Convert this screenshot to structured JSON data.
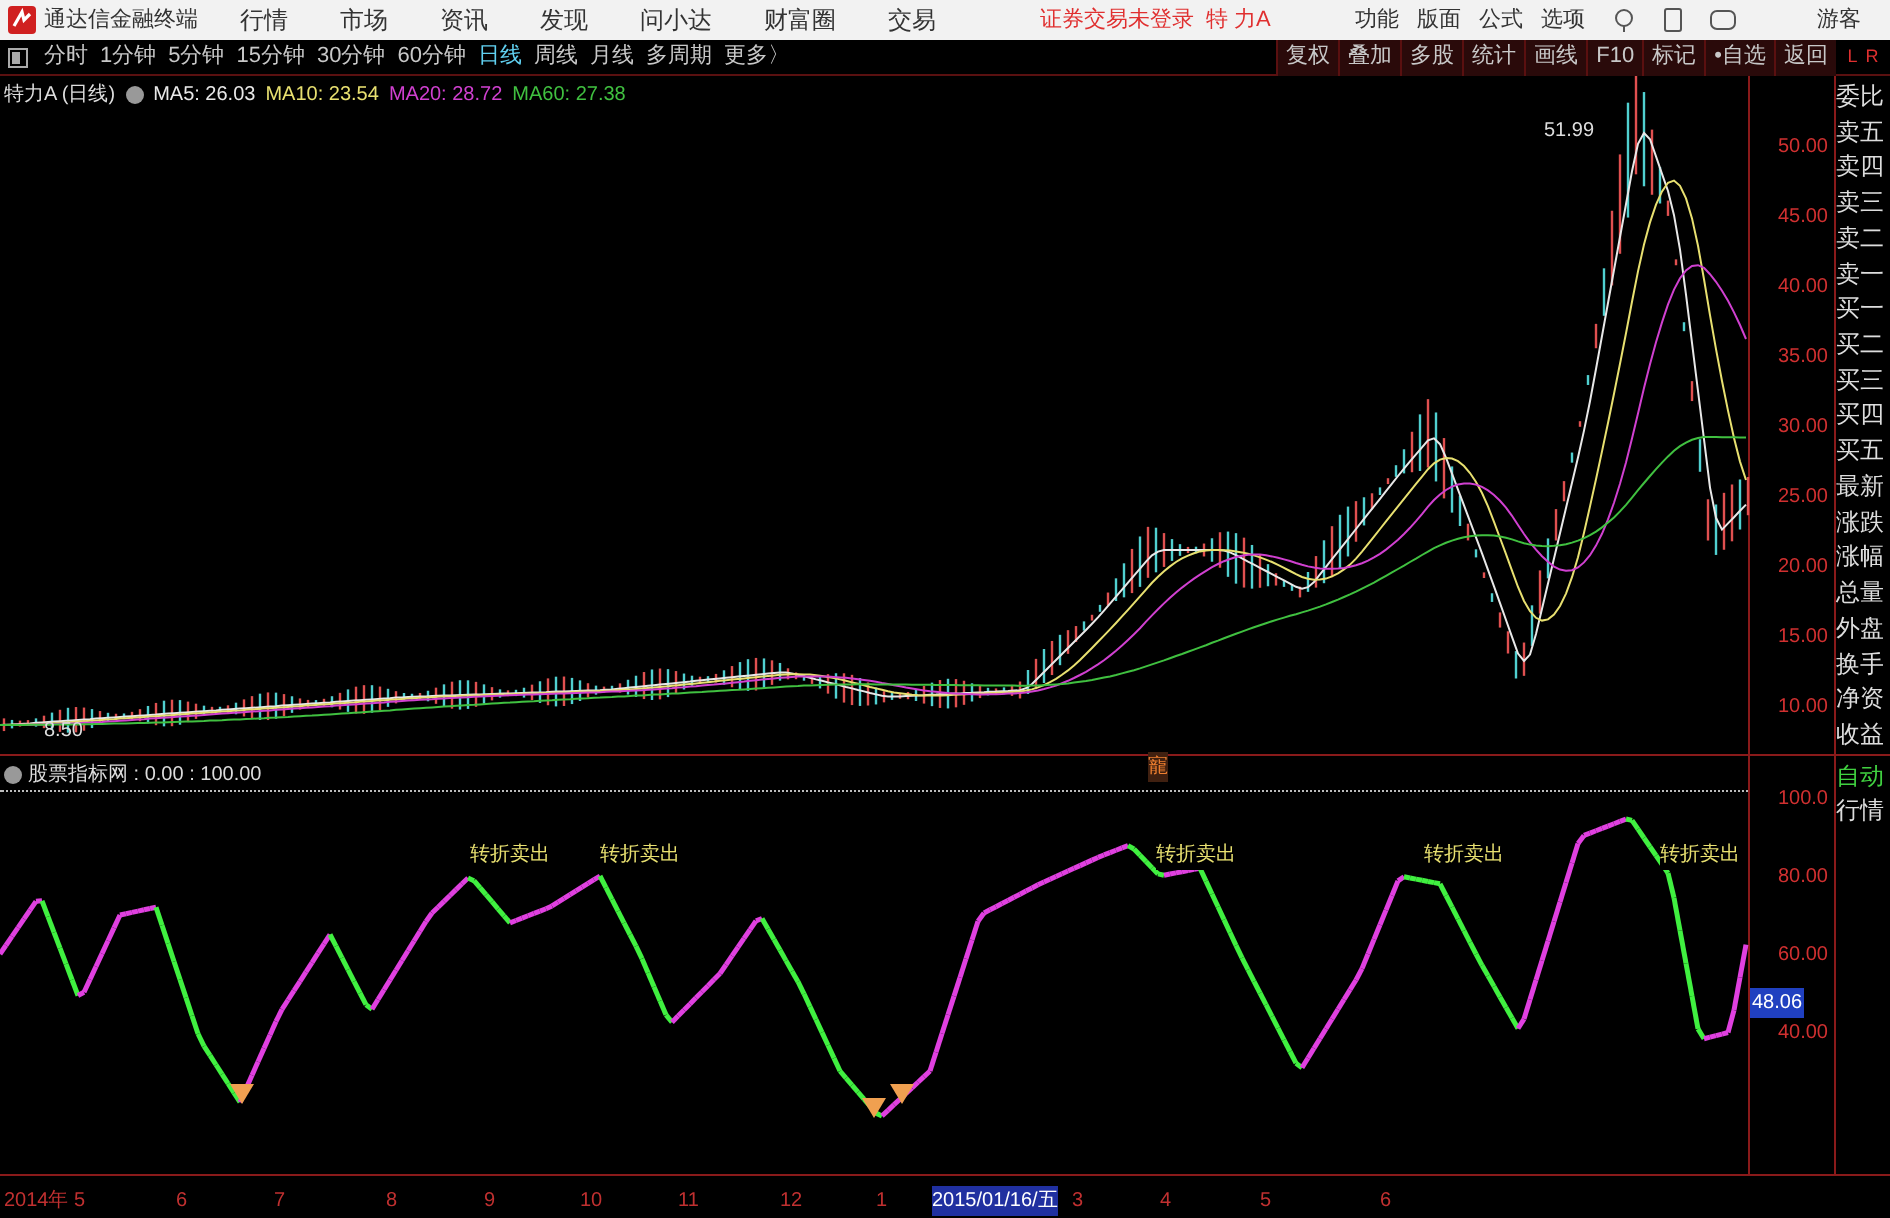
{
  "menu_bar": {
    "app_title": "通达信金融终端",
    "menus": [
      "行情",
      "市场",
      "资讯",
      "发现",
      "问小达",
      "财富圈",
      "交易"
    ],
    "notice": "证券交易未登录",
    "stock": "特 力A",
    "right_menus": [
      "功能",
      "版面",
      "公式",
      "选项"
    ],
    "user": "游客"
  },
  "toolbar": {
    "periods": [
      {
        "label": "分时",
        "selected": false
      },
      {
        "label": "1分钟",
        "selected": false
      },
      {
        "label": "5分钟",
        "selected": false
      },
      {
        "label": "15分钟",
        "selected": false
      },
      {
        "label": "30分钟",
        "selected": false
      },
      {
        "label": "60分钟",
        "selected": false
      },
      {
        "label": "日线",
        "selected": true
      },
      {
        "label": "周线",
        "selected": false
      },
      {
        "label": "月线",
        "selected": false
      },
      {
        "label": "多周期",
        "selected": false
      },
      {
        "label": "更多〉",
        "selected": false
      }
    ],
    "buttons": [
      "复权",
      "叠加",
      "多股",
      "统计",
      "画线",
      "F10",
      "标记",
      "•自选",
      "返回"
    ],
    "corner": [
      "L",
      "R"
    ]
  },
  "price_pane": {
    "title": "特力A (日线)",
    "ma": [
      {
        "label": "MA5: 26.03",
        "color": "#e8e8e8"
      },
      {
        "label": "MA10: 23.54",
        "color": "#e8e070"
      },
      {
        "label": "MA20: 28.72",
        "color": "#d040d0"
      },
      {
        "label": "MA60: 27.38",
        "color": "#40c040"
      }
    ],
    "high_label": "51.99",
    "low_label": "8.50",
    "marker": "寵",
    "yticks": [
      "50.00",
      "45.00",
      "40.00",
      "35.00",
      "30.00",
      "25.00",
      "20.00",
      "15.00",
      "10.00"
    ]
  },
  "quote_panel": {
    "items": [
      "委比",
      "卖五",
      "卖四",
      "卖三",
      "卖二",
      "卖一",
      "买一",
      "买二",
      "买三",
      "买四",
      "买五",
      "最新",
      "涨跌",
      "涨幅",
      "总量",
      "外盘",
      "换手",
      "净资",
      "收益"
    ],
    "bottom": [
      {
        "label": "自动",
        "kind": "active"
      },
      {
        "label": "行情",
        "kind": "plain"
      }
    ]
  },
  "indicator_pane": {
    "title": "股票指标网 : 0.00 : 100.00",
    "signals": [
      "转折卖出",
      "转折卖出",
      "转折卖出",
      "转折卖出",
      "转折卖出"
    ],
    "yticks": [
      "100.0",
      "80.00",
      "60.00",
      "40.00"
    ],
    "current": "48.06"
  },
  "date_axis": [
    {
      "label": "2014年 5",
      "kind": "month"
    },
    {
      "label": "6",
      "kind": "month"
    },
    {
      "label": "7",
      "kind": "month"
    },
    {
      "label": "8",
      "kind": "month"
    },
    {
      "label": "9",
      "kind": "month"
    },
    {
      "label": "10",
      "kind": "month"
    },
    {
      "label": "11",
      "kind": "month"
    },
    {
      "label": "12",
      "kind": "month"
    },
    {
      "label": "1",
      "kind": "month"
    },
    {
      "label": "2015/01/16/五",
      "kind": "cursor"
    },
    {
      "label": "3",
      "kind": "month"
    },
    {
      "label": "4",
      "kind": "month"
    },
    {
      "label": "5",
      "kind": "month"
    },
    {
      "label": "6",
      "kind": "month"
    }
  ]
}
